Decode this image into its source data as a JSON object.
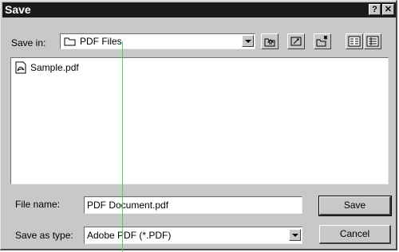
{
  "window": {
    "title": "Save",
    "help_label": "?",
    "close_label": "✕"
  },
  "save_in": {
    "label": "Save in:",
    "folder": "PDF Files"
  },
  "toolbar": {
    "up_icon": "up-folder-icon",
    "desktop_icon": "desktop-icon",
    "new_folder_icon": "new-folder-icon",
    "list_icon": "list-view-icon",
    "details_icon": "details-view-icon"
  },
  "files": [
    {
      "name": "Sample.pdf",
      "icon": "pdf-file-icon"
    }
  ],
  "file_name": {
    "label": "File name:",
    "value": "PDF Document.pdf"
  },
  "save_as_type": {
    "label": "Save as type:",
    "value": "Adobe PDF (*.PDF)"
  },
  "buttons": {
    "save": "Save",
    "cancel": "Cancel"
  }
}
